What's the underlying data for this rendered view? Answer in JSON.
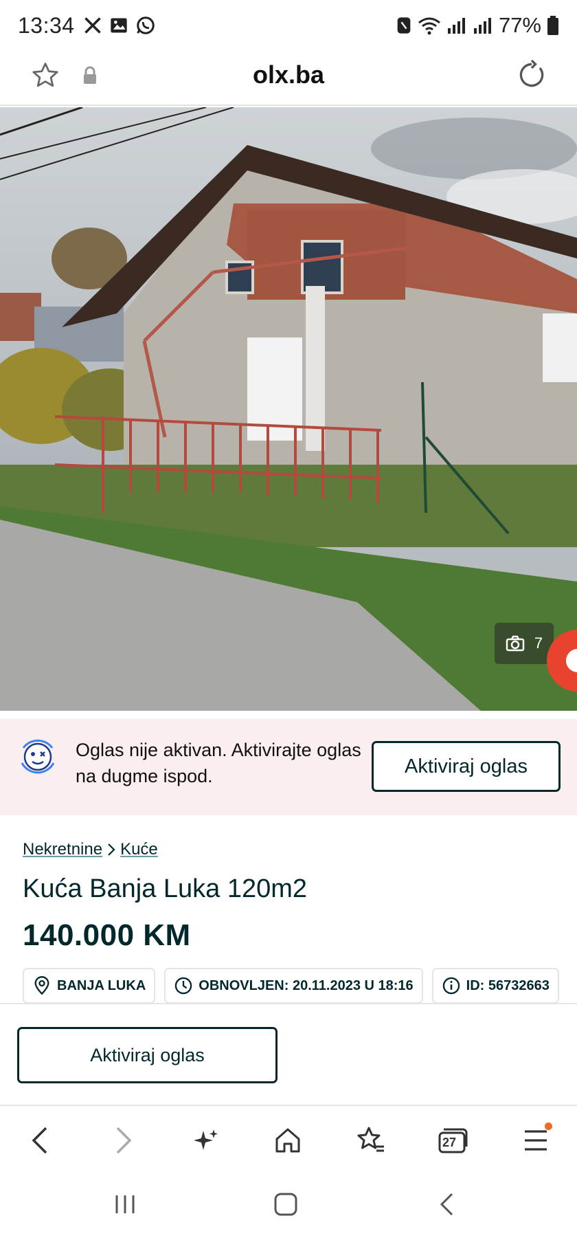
{
  "status_bar": {
    "time": "13:34",
    "battery_percent": "77%",
    "left_icons": [
      "x-logo-icon",
      "gallery-icon",
      "whatsapp-icon"
    ],
    "right_icons": [
      "nfc-icon",
      "wifi-icon",
      "signal-icon",
      "signal-icon",
      "battery-icon"
    ]
  },
  "browser": {
    "url": "olx.ba",
    "tab_count": "27"
  },
  "gallery": {
    "photo_count": "7",
    "active_index": 2,
    "dots_total": 4
  },
  "banner": {
    "message": "Oglas nije aktivan. Aktivirajte oglas na dugme ispod.",
    "button_label": "Aktiviraj oglas"
  },
  "listing": {
    "breadcrumb": [
      "Nekretnine",
      "Kuće"
    ],
    "title": "Kuća Banja Luka 120m2",
    "price": "140.000 KM",
    "location": "BANJA LUKA",
    "updated": "OBNOVLJEN: 20.11.2023 U 18:16",
    "id": "ID: 56732663"
  },
  "action": {
    "button_label": "Aktiviraj oglas"
  },
  "colors": {
    "brand_dark": "#02282c",
    "banner_bg": "#fbeeee",
    "accent_orange": "#f06a26",
    "fab_red": "#e8432f"
  }
}
